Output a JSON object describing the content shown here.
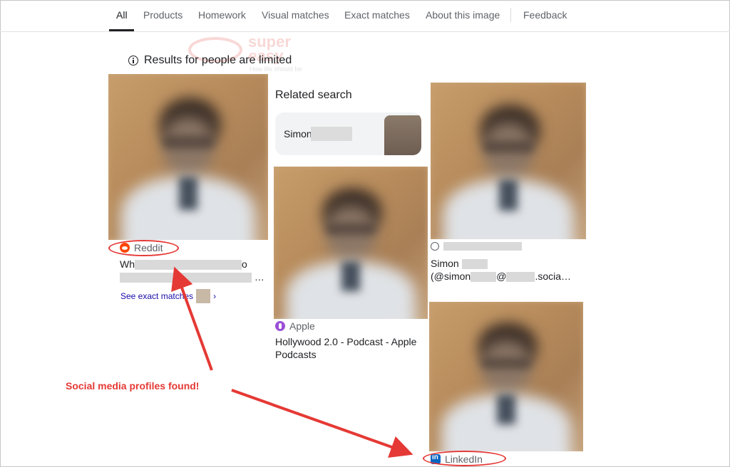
{
  "tabs": [
    {
      "label": "All",
      "active": true
    },
    {
      "label": "Products"
    },
    {
      "label": "Homework"
    },
    {
      "label": "Visual matches"
    },
    {
      "label": "Exact matches"
    },
    {
      "label": "About this image"
    },
    {
      "label": "Feedback"
    }
  ],
  "notice": {
    "text": "Results for people are limited",
    "icon": "info-icon"
  },
  "watermark": {
    "line1": "super",
    "line2": "easy",
    "line3": "How life should be"
  },
  "results": {
    "col1": {
      "source": "Reddit",
      "title": "Wh",
      "title_suffix": "o",
      "title_ellipsis": "…",
      "see_exact": "See exact matches",
      "chevron": "›"
    },
    "related": {
      "label": "Related search",
      "chip_text": "Simon"
    },
    "col2": {
      "source": "Apple",
      "title": "Hollywood 2.0 - Podcast - Apple Podcasts"
    },
    "col3": {
      "name": "Simon",
      "handle_start": "(@simon",
      "handle_mid": "@",
      "handle_end": ".socia…"
    },
    "col4": {
      "source": "LinkedIn"
    }
  },
  "annotation": {
    "text": "Social media profiles found!",
    "color": "#e53935"
  }
}
